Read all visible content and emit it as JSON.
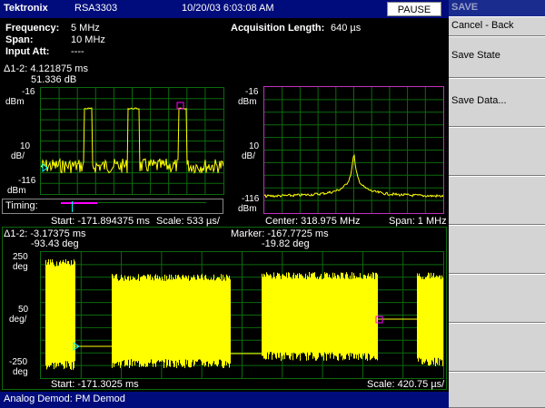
{
  "titlebar": {
    "brand": "Tektronix",
    "model": "RSA3303",
    "datetime": "10/20/03 6:03:08 AM",
    "pause_label": "PAUSE"
  },
  "settings": {
    "frequency_label": "Frequency:",
    "frequency_value": "5 MHz",
    "span_label": "Span:",
    "span_value": "10 MHz",
    "input_att_label": "Input Att:",
    "input_att_value": "----",
    "acq_label": "Acquisition Length:",
    "acq_value": "640 µs"
  },
  "timing_plot": {
    "delta_time": "Δ1-2: 4.121875 ms",
    "delta_level": "51.336 dB",
    "top_label": "-16",
    "unit_label": "dBm",
    "scale_value": "10",
    "scale_unit": "dB/",
    "bottom_label": "-116",
    "bottom_unit": "dBm",
    "timing_label": "Timing:",
    "start": "Start: -171.894375 ms",
    "scale": "Scale: 533 µs/"
  },
  "spectrum_plot": {
    "top_label": "-16",
    "unit_label": "dBm",
    "scale_value": "10",
    "scale_unit": "dB/",
    "bottom_label": "-116",
    "bottom_unit": "dBm",
    "center": "Center: 318.975 MHz",
    "span": "Span: 1 MHz"
  },
  "demod_plot": {
    "delta_time": "Δ1-2: -3.17375 ms",
    "delta_phase": "-93.43 deg",
    "marker_time": "Marker: -167.7725 ms",
    "marker_phase": "-19.82 deg",
    "top_label": "250",
    "top_unit": "deg",
    "mid_label": "50",
    "mid_unit": "deg/",
    "bottom_label": "-250",
    "bottom_unit": "deg",
    "start": "Start: -171.3025 ms",
    "scale": "Scale: 420.75 µs/"
  },
  "softkeys": {
    "header": "SAVE",
    "cancel": "Cancel - Back",
    "save_state": "Save State",
    "save_data": "Save Data..."
  },
  "status": {
    "text": "Analog Demod: PM Demod"
  },
  "colors": {
    "trace": "#ffff00",
    "grid": "#0c6a0c",
    "title_bg": "#000c7b",
    "marker": "#ff00ff"
  }
}
